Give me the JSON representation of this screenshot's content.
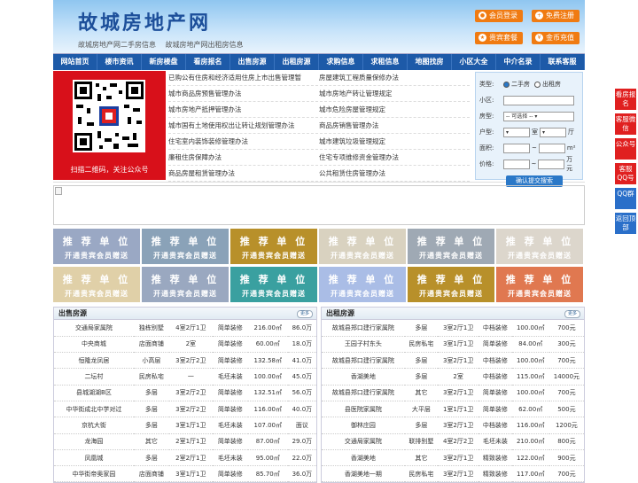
{
  "header": {
    "logo": "故城房地产网",
    "sub1": "故城房地产网二手房信息",
    "sub2": "故城房地产网出租房信息",
    "buttons": [
      "会员登录",
      "免费注册",
      "贵宾套餐",
      "金币充值"
    ]
  },
  "nav": [
    "网站首页",
    "楼市资讯",
    "新房楼盘",
    "看房报名",
    "出售房源",
    "出租房源",
    "求购信息",
    "求租信息",
    "地图找房",
    "小区大全",
    "中介名录",
    "联系客服"
  ],
  "qr": {
    "caption": "扫描二维码，关注公众号"
  },
  "links": [
    [
      "已购公有住房和经济适用住房上市出售管理暂",
      "房屋建筑工程质量保修办法"
    ],
    [
      "城市商品房预售管理办法",
      "城市房地产转让管理规定"
    ],
    [
      "城市房地产抵押管理办法",
      "城市危险房屋管理规定"
    ],
    [
      "城市国有土地使用权出让转让规划管理办法",
      "商品房销售管理办法"
    ],
    [
      "住宅室内装饰装修管理办法",
      "城市建筑垃圾管理规定"
    ],
    [
      "廉租住房保障办法",
      "住宅专项维修资金管理办法"
    ],
    [
      "商品房屋租赁管理办法",
      "公共租赁住房管理办法"
    ]
  ],
  "search": {
    "type_label": "类型:",
    "opt1": "二手房",
    "opt2": "出租房",
    "community_label": "小区:",
    "house_label": "房型:",
    "select_default": "-- 可选择 --",
    "layout_label": "户型:",
    "room": "室",
    "hall": "厅",
    "area_label": "面积:",
    "area_unit": "m²",
    "price_label": "价格:",
    "price_unit": "万元",
    "tilde": "~",
    "submit": "确认提交搜索"
  },
  "ad": {
    "t1": "推 荐 单 位",
    "t2": "开通贵宾会员赠送",
    "colors": [
      "#9aa8c4",
      "#8aa2b8",
      "#b8902a",
      "#d9d2c0",
      "#9fa9b4",
      "#dcd6cc",
      "#e0d0a8",
      "#9aa8c0",
      "#3aa0a0",
      "#aabde6",
      "#b8902a",
      "#e07850"
    ]
  },
  "sale": {
    "title": "出售房源",
    "more": "更多",
    "rows": [
      [
        "交通局家属院",
        "独栋别墅",
        "4室2厅1卫",
        "简单装修",
        "216.00㎡",
        "86.0万"
      ],
      [
        "中央商城",
        "店面商铺",
        "2室",
        "简单装修",
        "60.00㎡",
        "18.0万"
      ],
      [
        "恒隆龙凤居",
        "小高层",
        "3室2厅2卫",
        "简单装修",
        "132.58㎡",
        "41.0万"
      ],
      [
        "二坛村",
        "民房私宅",
        "一",
        "毛坯未装",
        "100.00㎡",
        "45.0万"
      ],
      [
        "县城湖湖B区",
        "多层",
        "3室2厅2卫",
        "简单装修",
        "132.51㎡",
        "56.0万"
      ],
      [
        "中华街成北中学对过",
        "多层",
        "3室2厅2卫",
        "简单装修",
        "116.00㎡",
        "40.0万"
      ],
      [
        "京杭大街",
        "多层",
        "3室1厅1卫",
        "毛坯未装",
        "107.00㎡",
        "面议"
      ],
      [
        "龙海园",
        "其它",
        "2室1厅1卫",
        "简单装修",
        "87.00㎡",
        "29.0万"
      ],
      [
        "凤凰城",
        "多层",
        "2室2厅1卫",
        "毛坯未装",
        "95.00㎡",
        "22.0万"
      ],
      [
        "中华街帝奥家园",
        "店面商铺",
        "3室1厅1卫",
        "简单装修",
        "85.70㎡",
        "36.0万"
      ]
    ]
  },
  "rent": {
    "title": "出租房源",
    "more": "更多",
    "rows": [
      [
        "故城县郑口建行家属院",
        "多层",
        "3室2厅1卫",
        "中档装修",
        "100.00㎡",
        "700元"
      ],
      [
        "王园子村东头",
        "民房私宅",
        "3室1厅1卫",
        "简单装修",
        "84.00㎡",
        "300元"
      ],
      [
        "故城县郑口建行家属院",
        "多层",
        "3室2厅1卫",
        "中档装修",
        "100.00㎡",
        "700元"
      ],
      [
        "香湖美地",
        "多层",
        "2室",
        "中档装修",
        "115.00㎡",
        "14000元"
      ],
      [
        "故城县郑口建行家属院",
        "其它",
        "3室2厅1卫",
        "简单装修",
        "100.00㎡",
        "700元"
      ],
      [
        "县医院家属院",
        "大平层",
        "1室1厅1卫",
        "简单装修",
        "62.00㎡",
        "500元"
      ],
      [
        "御林庄园",
        "多层",
        "3室2厅1卫",
        "中档装修",
        "116.00㎡",
        "1200元"
      ],
      [
        "交通局家属院",
        "联排别墅",
        "4室2厅2卫",
        "毛坯未装",
        "210.00㎡",
        "800元"
      ],
      [
        "香湖美地",
        "其它",
        "3室2厅1卫",
        "精致装修",
        "122.00㎡",
        "900元"
      ],
      [
        "香湖美地一期",
        "民房私宅",
        "3室2厅1卫",
        "精致装修",
        "117.00㎡",
        "700元"
      ]
    ]
  },
  "side": [
    "看房报名",
    "客服微信",
    "公众号",
    "客服QQ号",
    "QQ群",
    "返回顶部"
  ]
}
